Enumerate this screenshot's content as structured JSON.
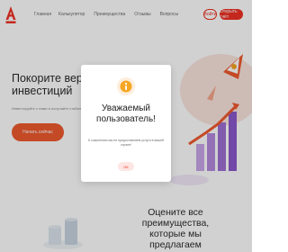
{
  "header": {
    "nav": [
      "Главная",
      "Калькулятор",
      "Преимущества",
      "Отзывы",
      "Вопросы"
    ],
    "login_label": "Войти",
    "open_label": "Открыть счёт"
  },
  "hero": {
    "title": "Покорите вершины инвестиций",
    "subtitle": "Инвестируйте с нами и получайте стабильный доход",
    "cta_label": "Начать сейчас"
  },
  "section": {
    "title": "Оцените все преимущества, которые мы предлагаем"
  },
  "modal": {
    "title": "Уважаемый пользователь!",
    "text": "К сожалению мы не предоставляем услуги в вашей стране!",
    "ok_label": "ОК"
  },
  "colors": {
    "brand": "#ef3124",
    "accent": "#ef5a2e",
    "icon_bg": "#f6a623"
  }
}
